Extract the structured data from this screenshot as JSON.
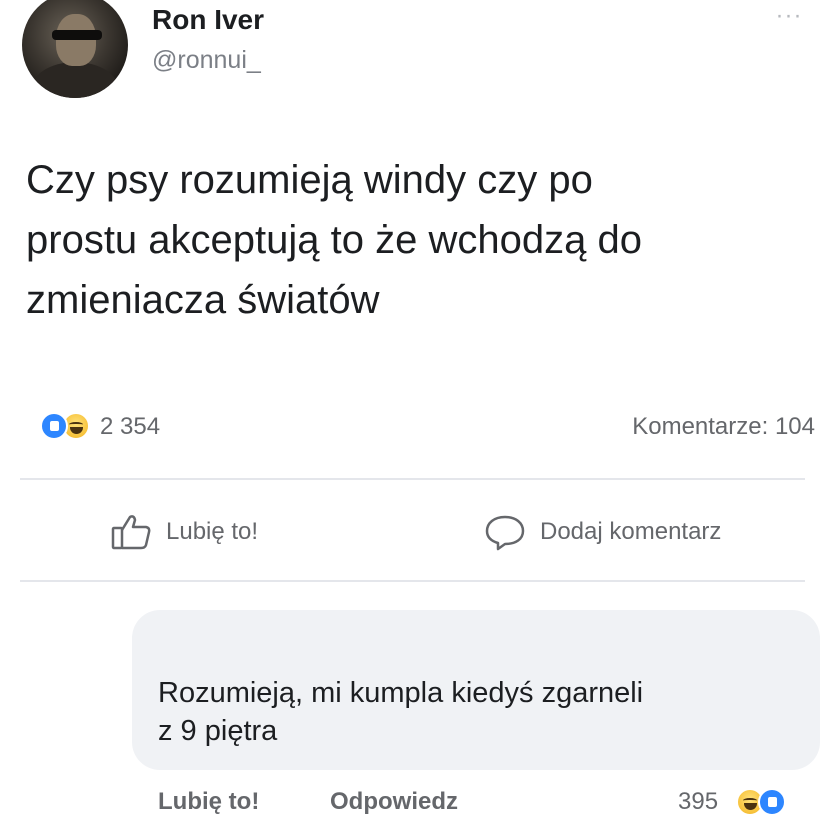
{
  "post": {
    "author_name": "Ron Iver",
    "author_handle": "@ronnui_",
    "more_label": "···",
    "text_lines": [
      "Czy psy rozumieją windy czy po",
      "prostu akceptują to że wchodzą do",
      "zmieniacza światów"
    ],
    "reaction_count": "2 354",
    "comments_label": "Komentarze: 104",
    "reactions": [
      "like-icon",
      "haha-icon"
    ]
  },
  "actions": {
    "like_label": "Lubię to!",
    "comment_label": "Dodaj komentarz"
  },
  "comment": {
    "text_lines": [
      "Rozumieją, mi kumpla kiedyś zgarneli",
      "z 9 piętra"
    ],
    "like_label": "Lubię to!",
    "reply_label": "Odpowiedz",
    "reaction_count": "395",
    "reactions": [
      "haha-icon",
      "like-icon"
    ]
  },
  "colors": {
    "like_blue": "#2d86ff",
    "haha_yellow": "#f7c23b",
    "comment_bg": "#f0f2f5",
    "secondary_text": "#65676b"
  }
}
